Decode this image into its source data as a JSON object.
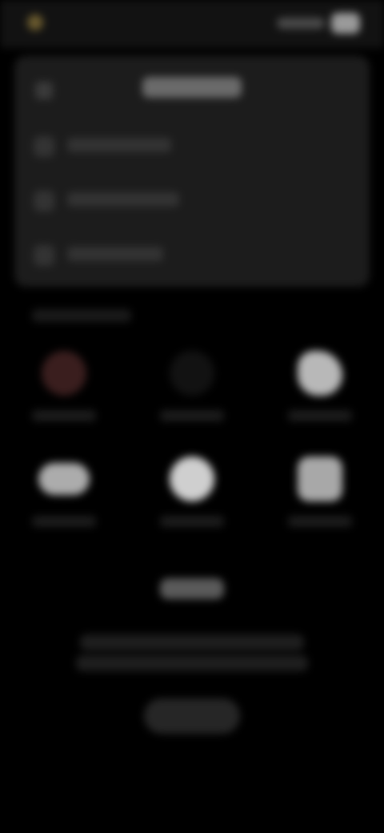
{
  "status_bar": {
    "app_icon": "app-dot-icon",
    "app_name": "",
    "battery_icon": "battery-icon",
    "signal_icon": "signal-icon"
  },
  "settings_card": {
    "back_icon": "back-icon",
    "back_label": "",
    "title": "",
    "rows": [
      {
        "icon": "list-icon",
        "label": ""
      },
      {
        "icon": "list-icon",
        "label": ""
      },
      {
        "icon": "list-icon",
        "label": ""
      }
    ]
  },
  "section_label": "",
  "grid": [
    {
      "icon": "red-circle-icon",
      "label": "",
      "color": "#5a2e2e"
    },
    {
      "icon": "dark-circle-icon",
      "label": "",
      "color": "#1a1a1a"
    },
    {
      "icon": "brush-icon",
      "label": "",
      "color": "#bcbcbc"
    },
    {
      "icon": "cloud-icon",
      "label": "",
      "color": "#b0b0b0"
    },
    {
      "icon": "sun-icon",
      "label": "",
      "color": "#cccccc"
    },
    {
      "icon": "square-icon",
      "label": "",
      "color": "#a8a8a8"
    }
  ],
  "bottom": {
    "heading": "",
    "text_line_1": "",
    "text_line_2": "",
    "button_label": ""
  }
}
